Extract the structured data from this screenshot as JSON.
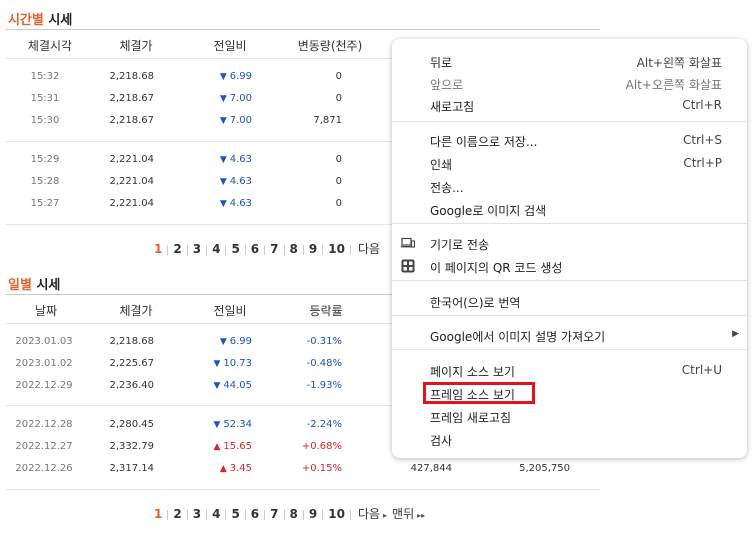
{
  "hourly": {
    "title_accent": "시간별",
    "title_rest": " 시세",
    "headers": [
      "체결시각",
      "체결가",
      "전일비",
      "변동량(천주)"
    ],
    "rows": [
      {
        "time": "15:32",
        "price": "2,218.68",
        "dir": "down",
        "diff": "6.99",
        "vol": "0"
      },
      {
        "time": "15:31",
        "price": "2,218.67",
        "dir": "down",
        "diff": "7.00",
        "vol": "0"
      },
      {
        "time": "15:30",
        "price": "2,218.67",
        "dir": "down",
        "diff": "7.00",
        "vol": "7,871"
      },
      {
        "time": "15:29",
        "price": "2,221.04",
        "dir": "down",
        "diff": "4.63",
        "vol": "0"
      },
      {
        "time": "15:28",
        "price": "2,221.04",
        "dir": "down",
        "diff": "4.63",
        "vol": "0"
      },
      {
        "time": "15:27",
        "price": "2,221.04",
        "dir": "down",
        "diff": "4.63",
        "vol": "0"
      }
    ],
    "pages": [
      "1",
      "2",
      "3",
      "4",
      "5",
      "6",
      "7",
      "8",
      "9",
      "10"
    ],
    "next_label": "다음"
  },
  "daily": {
    "title_accent": "일별",
    "title_rest": " 시세",
    "headers": [
      "날짜",
      "체결가",
      "전일비",
      "등락률"
    ],
    "rows": [
      {
        "date": "2023.01.03",
        "price": "2,218.68",
        "dir": "down",
        "diff": "6.99",
        "rate": "-0.31%",
        "vol": "",
        "amt": ""
      },
      {
        "date": "2023.01.02",
        "price": "2,225.67",
        "dir": "down",
        "diff": "10.73",
        "rate": "-0.48%",
        "vol": "",
        "amt": ""
      },
      {
        "date": "2022.12.29",
        "price": "2,236.40",
        "dir": "down",
        "diff": "44.05",
        "rate": "-1.93%",
        "vol": "",
        "amt": ""
      },
      {
        "date": "2022.12.28",
        "price": "2,280.45",
        "dir": "down",
        "diff": "52.34",
        "rate": "-2.24%",
        "vol": "",
        "amt": ""
      },
      {
        "date": "2022.12.27",
        "price": "2,332.79",
        "dir": "up",
        "diff": "15.65",
        "rate": "+0.68%",
        "vol": "",
        "amt": ""
      },
      {
        "date": "2022.12.26",
        "price": "2,317.14",
        "dir": "up",
        "diff": "3.45",
        "rate": "+0.15%",
        "vol": "427,844",
        "amt": "5,205,750"
      }
    ],
    "pages": [
      "1",
      "2",
      "3",
      "4",
      "5",
      "6",
      "7",
      "8",
      "9",
      "10"
    ],
    "next_label": "다음",
    "last_label": "맨뒤"
  },
  "arrows": {
    "down": "▼",
    "up": "▲"
  },
  "context_menu": {
    "items": [
      {
        "label": "뒤로",
        "shortcut": "Alt+왼쪽 화살표"
      },
      {
        "label": "앞으로",
        "shortcut": "Alt+오른쪽 화살표",
        "disabled": true
      },
      {
        "label": "새로고침",
        "shortcut": "Ctrl+R"
      },
      {
        "label": "다른 이름으로 저장...",
        "shortcut": "Ctrl+S"
      },
      {
        "label": "인쇄",
        "shortcut": "Ctrl+P"
      },
      {
        "label": "전송...",
        "shortcut": ""
      },
      {
        "label": "Google로 이미지 검색",
        "shortcut": ""
      },
      {
        "label": "기기로 전송",
        "shortcut": "",
        "icon": "devices-icon"
      },
      {
        "label": "이 페이지의 QR 코드 생성",
        "shortcut": "",
        "icon": "qr-code-icon"
      },
      {
        "label": "한국어(으)로 번역",
        "shortcut": ""
      },
      {
        "label": "Google에서 이미지 설명 가져오기",
        "shortcut": "",
        "submenu": true
      },
      {
        "label": "페이지 소스 보기",
        "shortcut": "Ctrl+U"
      },
      {
        "label": "프레임 소스 보기",
        "shortcut": "",
        "highlighted": true
      },
      {
        "label": "프레임 새로고침",
        "shortcut": ""
      },
      {
        "label": "검사",
        "shortcut": ""
      }
    ]
  },
  "colors": {
    "accent": "#e8612c",
    "down": "#1a55c8",
    "up": "#d8232a",
    "highlight_border": "#e0141d"
  }
}
